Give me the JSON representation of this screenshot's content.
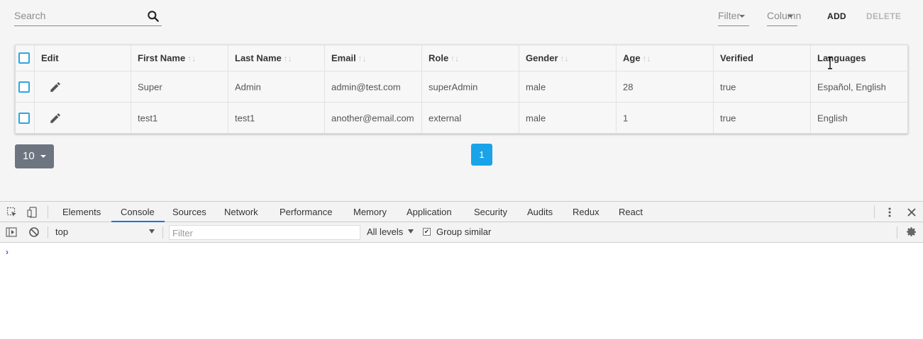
{
  "search": {
    "placeholder": "Search",
    "icon": "search-icon"
  },
  "filters": {
    "filter_label": "Filter",
    "column_label": "Column"
  },
  "actions": {
    "add_label": "ADD",
    "delete_label": "DELETE"
  },
  "table": {
    "headers": [
      "Edit",
      "First Name",
      "Last Name",
      "Email",
      "Role",
      "Gender",
      "Age",
      "Verified",
      "Languages"
    ],
    "sort_glyph": "↑↓",
    "rows": [
      {
        "first_name": "Super",
        "last_name": "Admin",
        "email": "admin@test.com",
        "role": "superAdmin",
        "gender": "male",
        "age": "28",
        "verified": "true",
        "languages": "Español, English"
      },
      {
        "first_name": "test1",
        "last_name": "test1",
        "email": "another@email.com",
        "role": "external",
        "gender": "male",
        "age": "1",
        "verified": "true",
        "languages": "English"
      }
    ]
  },
  "pagination": {
    "page_size": "10",
    "current_page": "1"
  },
  "devtools": {
    "tabs": [
      "Elements",
      "Console",
      "Sources",
      "Network",
      "Performance",
      "Memory",
      "Application",
      "Security",
      "Audits",
      "Redux",
      "React"
    ],
    "active_tab": "Console",
    "context": "top",
    "filter_placeholder": "Filter",
    "levels": "All levels",
    "group_similar": "Group similar",
    "prompt": "›"
  },
  "colors": {
    "accent": "#1aa3e8",
    "checkbox": "#2ea6e3",
    "page_size_bg": "#6c7580",
    "devtools_active": "#1a73e8"
  }
}
